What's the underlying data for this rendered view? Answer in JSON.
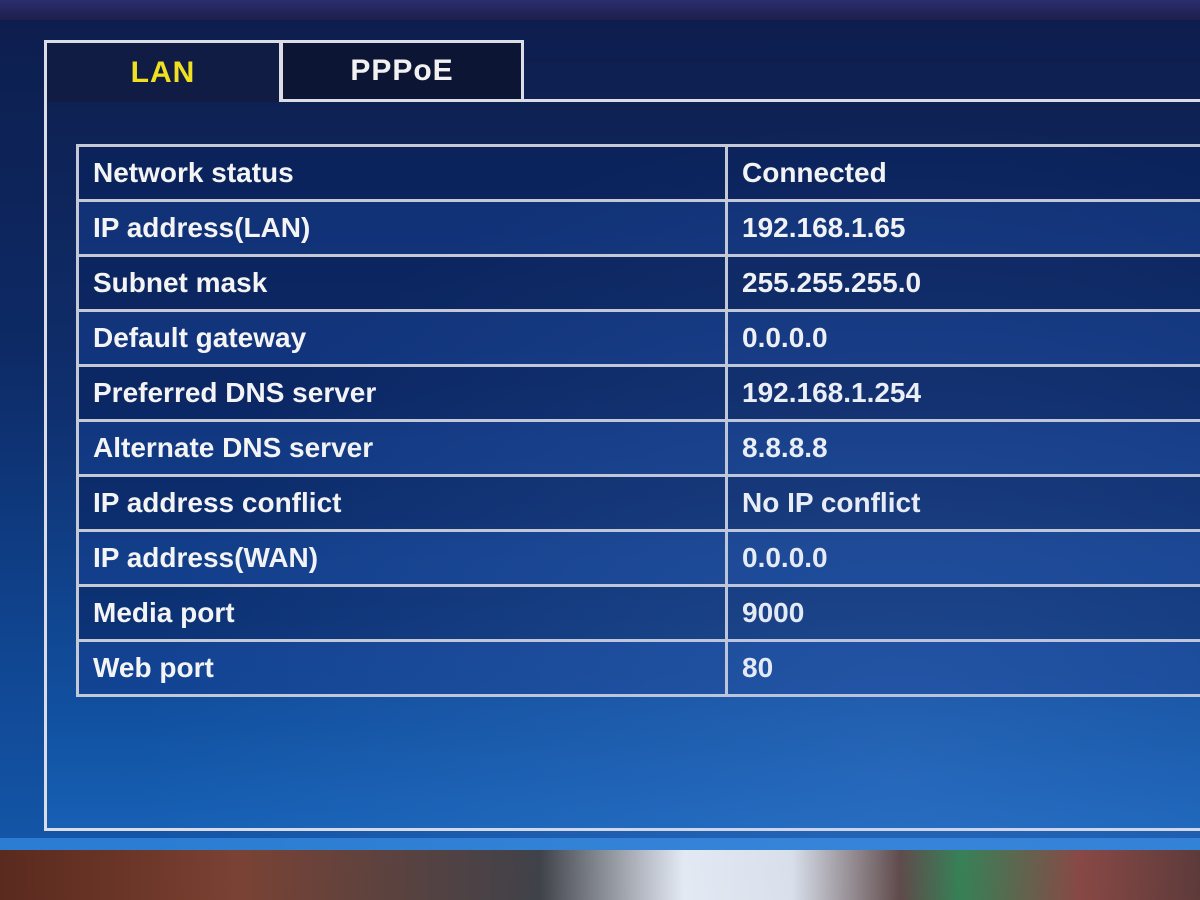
{
  "tabs": [
    {
      "label": "LAN",
      "active": true
    },
    {
      "label": "PPPoE",
      "active": false
    }
  ],
  "colors": {
    "active_tab_text": "#f0e020",
    "panel_blue": "#1150a0",
    "border": "#dcdce6"
  },
  "network_info": [
    {
      "label": "Network status",
      "value": "Connected"
    },
    {
      "label": "IP address(LAN)",
      "value": "192.168.1.65"
    },
    {
      "label": "Subnet mask",
      "value": "255.255.255.0"
    },
    {
      "label": "Default gateway",
      "value": "0.0.0.0"
    },
    {
      "label": "Preferred DNS server",
      "value": "192.168.1.254"
    },
    {
      "label": "Alternate DNS server",
      "value": "8.8.8.8"
    },
    {
      "label": "IP address conflict",
      "value": "No IP conflict"
    },
    {
      "label": "IP address(WAN)",
      "value": "0.0.0.0"
    },
    {
      "label": "Media port",
      "value": "9000"
    },
    {
      "label": "Web port",
      "value": "80"
    }
  ]
}
